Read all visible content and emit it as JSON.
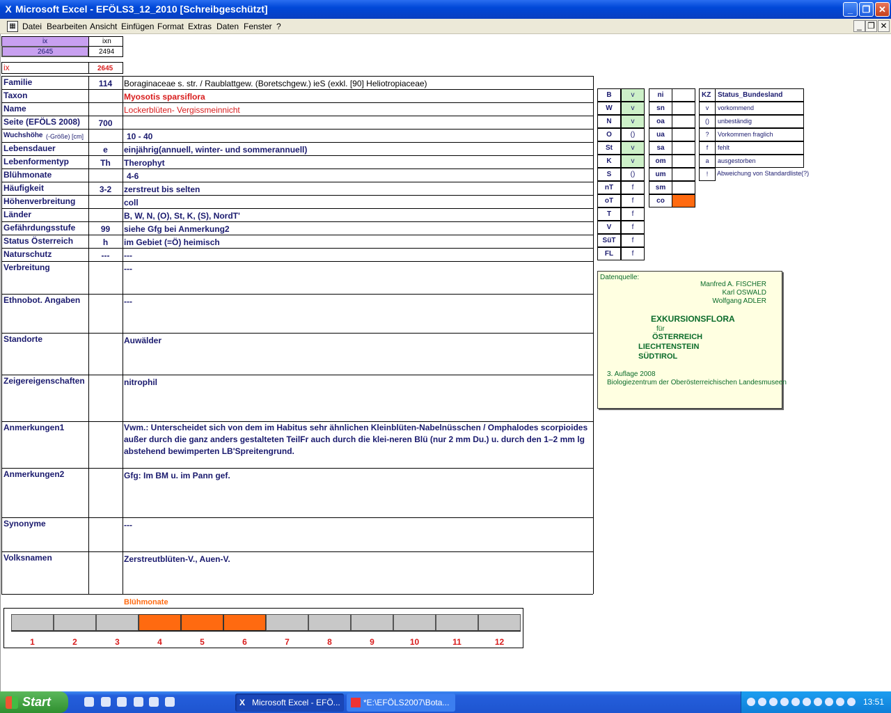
{
  "window": {
    "title": "Microsoft Excel - EFÖLS3_12_2010  [Schreibgeschützt]"
  },
  "menu": [
    "Datei",
    "Bearbeiten",
    "Ansicht",
    "Einfügen",
    "Format",
    "Extras",
    "Daten",
    "Fenster",
    "?"
  ],
  "top": {
    "ix_label": "ix",
    "ixn_label": "ixn",
    "ix_value": "2645",
    "ixn_value": "2494",
    "ix_row_label": "ix",
    "ix_row_value": "2645"
  },
  "rows": [
    {
      "label": "Familie",
      "code": "114",
      "value": "Boraginaceae s. str.  /  Raublattgew. (Boretschgew.) ieS (exkl. [90] Heliotropiaceae)"
    },
    {
      "label": "Taxon",
      "code": "",
      "value": "Myosotis sparsiflora"
    },
    {
      "label": "Name",
      "code": "",
      "value": "Lockerblüten- Vergissmeinnicht"
    },
    {
      "label": "Seite (EFÖLS 2008)",
      "code": "700",
      "value": ""
    },
    {
      "label": "Wuchshöhe",
      "label_sub": "(-Größe) [cm]",
      "code": "",
      "value": "10 - 40"
    },
    {
      "label": "Lebensdauer",
      "code": "e",
      "value": "einjährig(annuell, winter- und sommerannuell)"
    },
    {
      "label": "Lebenformentyp",
      "code": "Th",
      "value": "Therophyt"
    },
    {
      "label": "Blühmonate",
      "code": "",
      "value": "4-6"
    },
    {
      "label": "Häufigkeit",
      "code": "3-2",
      "value": "zerstreut bis selten"
    },
    {
      "label": "Höhenverbreitung",
      "code": "",
      "value": "coll"
    },
    {
      "label": "Länder",
      "code": "",
      "value": "B, W, N, (O), St, K, (S), NordT'"
    },
    {
      "label": "Gefährdungsstufe",
      "code": "99",
      "value": "siehe Gfg bei Anmerkung2"
    },
    {
      "label": "Status Österreich",
      "code": "h",
      "value": "im Gebiet (=Ö) heimisch"
    },
    {
      "label": "Naturschutz",
      "code": "---",
      "value": "---"
    },
    {
      "label": "Verbreitung",
      "code": "",
      "value": "---"
    },
    {
      "label": "Ethnobot. Angaben",
      "code": "",
      "value": "---"
    },
    {
      "label": "Standorte",
      "code": "",
      "value": "Auwälder"
    },
    {
      "label": "Zeigereigenschaften",
      "code": "",
      "value": "nitrophil"
    },
    {
      "label": "Anmerkungen1",
      "code": "",
      "value": [
        "Vwm.: Unterscheidet sich von dem im Habitus sehr ähnlichen Kleinblüten-Nabelnüsschen / Omphalodes scorpioides",
        "außer durch die ganz anders gestalteten TeilFr auch durch die klei-neren Blü (nur 2 mm Du.) u. durch den 1–2 mm lg",
        "abstehend bewimperten LB'Spreitengrund."
      ]
    },
    {
      "label": "Anmerkungen2",
      "code": "",
      "value": "Gfg:  Im BM u. im Pann gef."
    },
    {
      "label": "Synonyme",
      "code": "",
      "value": "---"
    },
    {
      "label": "Volksnamen",
      "code": "",
      "value": "Zerstreutblüten-V., Auen-V."
    }
  ],
  "status_grid": [
    {
      "k": "B",
      "v": "v",
      "g": true
    },
    {
      "k": "W",
      "v": "v",
      "g": true
    },
    {
      "k": "N",
      "v": "v",
      "g": true
    },
    {
      "k": "O",
      "v": "()",
      "g": false
    },
    {
      "k": "St",
      "v": "v",
      "g": true
    },
    {
      "k": "K",
      "v": "v",
      "g": true
    },
    {
      "k": "S",
      "v": "()",
      "g": false
    },
    {
      "k": "nT",
      "v": "f",
      "g": false
    },
    {
      "k": "oT",
      "v": "f",
      "g": false
    },
    {
      "k": "T",
      "v": "f",
      "g": false
    },
    {
      "k": "V",
      "v": "f",
      "g": false
    },
    {
      "k": "SüT",
      "v": "f",
      "g": false
    },
    {
      "k": "FL",
      "v": "f",
      "g": false
    }
  ],
  "status_grid2": [
    {
      "k": "ni",
      "v": ""
    },
    {
      "k": "sn",
      "v": ""
    },
    {
      "k": "oa",
      "v": ""
    },
    {
      "k": "ua",
      "v": ""
    },
    {
      "k": "sa",
      "v": ""
    },
    {
      "k": "om",
      "v": ""
    },
    {
      "k": "um",
      "v": ""
    },
    {
      "k": "sm",
      "v": ""
    },
    {
      "k": "co",
      "v": "",
      "orange": true
    }
  ],
  "legend": {
    "header_kz": "KZ",
    "header_title": "Status_Bundesland",
    "items": [
      {
        "k": "v",
        "t": "vorkommend"
      },
      {
        "k": "()",
        "t": "unbeständig"
      },
      {
        "k": "?",
        "t": "Vorkommen fraglich"
      },
      {
        "k": "f",
        "t": "fehlt"
      },
      {
        "k": "a",
        "t": "ausgestorben"
      },
      {
        "k": "!",
        "t": "Abweichung von Standardliste(?)"
      }
    ]
  },
  "datasource": {
    "heading": "Datenquelle:",
    "authors": [
      "Manfred A. FISCHER",
      "Karl OSWALD",
      "Wolfgang ADLER"
    ],
    "title": "EXKURSIONSFLORA",
    "fuer": "für",
    "countries": [
      "ÖSTERREICH",
      "LIECHTENSTEIN",
      "SÜDTIROL"
    ],
    "edition": "3. Auflage 2008",
    "publisher": "Biologiezentrum der Oberösterreichischen Landesmuseen"
  },
  "chart_data": {
    "type": "bar",
    "title": "Blühmonate",
    "categories": [
      "1",
      "2",
      "3",
      "4",
      "5",
      "6",
      "7",
      "8",
      "9",
      "10",
      "11",
      "12"
    ],
    "values": [
      0,
      0,
      0,
      1,
      1,
      1,
      0,
      0,
      0,
      0,
      0,
      0
    ],
    "colors": {
      "on": "#ff6a10",
      "off": "#c8c8c8"
    }
  },
  "taskbar": {
    "start": "Start",
    "tasks": [
      "Microsoft Excel - EFÖ...",
      "*E:\\EFÖLS2007\\Bota..."
    ],
    "clock": "13:51"
  }
}
